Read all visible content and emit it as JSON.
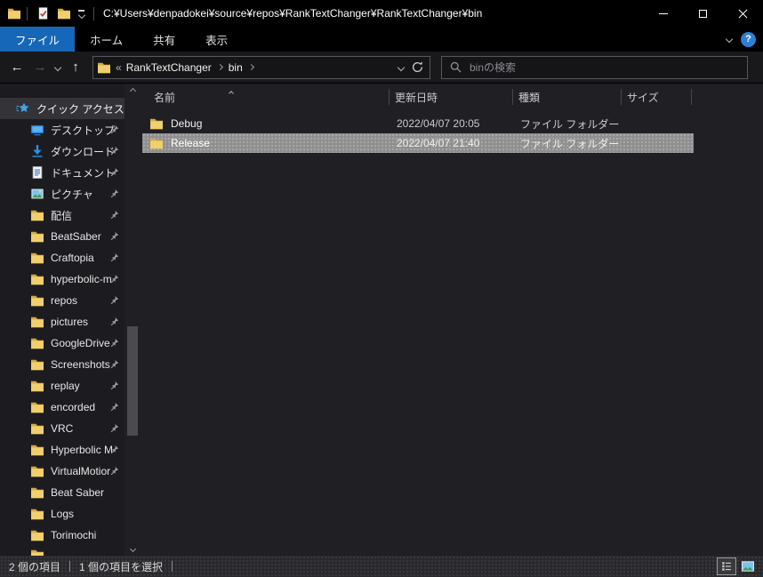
{
  "window": {
    "title_path": "C:¥Users¥denpadokei¥source¥repos¥RankTextChanger¥RankTextChanger¥bin"
  },
  "ribbon": {
    "tabs": [
      {
        "label": "ファイル",
        "active": true
      },
      {
        "label": "ホーム",
        "active": false
      },
      {
        "label": "共有",
        "active": false
      },
      {
        "label": "表示",
        "active": false
      }
    ],
    "help_glyph": "?"
  },
  "navbar": {
    "back_glyph": "←",
    "forward_glyph": "→",
    "up_glyph": "↑",
    "breadcrumb_overflow": "«",
    "breadcrumb": [
      {
        "label": "RankTextChanger"
      },
      {
        "label": "bin"
      }
    ],
    "search_placeholder": "binの検索"
  },
  "sidebar": {
    "quick_access_label": "クイック アクセス",
    "quick_access_icon": "quick-access-star-icon",
    "items": [
      {
        "label": "デスクトップ",
        "icon": "desktop-icon",
        "pinned": true
      },
      {
        "label": "ダウンロード",
        "icon": "download-icon",
        "pinned": true
      },
      {
        "label": "ドキュメント",
        "icon": "document-icon",
        "pinned": true
      },
      {
        "label": "ピクチャ",
        "icon": "picture-icon",
        "pinned": true
      },
      {
        "label": "配信",
        "icon": "folder-icon",
        "pinned": true
      },
      {
        "label": "BeatSaber",
        "icon": "folder-icon",
        "pinned": true
      },
      {
        "label": "Craftopia",
        "icon": "folder-icon",
        "pinned": true
      },
      {
        "label": "hyperbolic-m",
        "icon": "folder-icon",
        "pinned": true
      },
      {
        "label": "repos",
        "icon": "folder-icon",
        "pinned": true
      },
      {
        "label": "pictures",
        "icon": "folder-icon",
        "pinned": true
      },
      {
        "label": "GoogleDrive",
        "icon": "folder-icon",
        "pinned": true
      },
      {
        "label": "Screenshots",
        "icon": "folder-icon",
        "pinned": true
      },
      {
        "label": "replay",
        "icon": "folder-icon",
        "pinned": true
      },
      {
        "label": "encorded",
        "icon": "folder-icon",
        "pinned": true
      },
      {
        "label": "VRC",
        "icon": "folder-icon",
        "pinned": true
      },
      {
        "label": "Hyperbolic M",
        "icon": "folder-icon",
        "pinned": true
      },
      {
        "label": "VirtualMotior",
        "icon": "folder-icon",
        "pinned": true
      },
      {
        "label": "Beat Saber",
        "icon": "folder-icon",
        "pinned": false
      },
      {
        "label": "Logs",
        "icon": "folder-icon",
        "pinned": false
      },
      {
        "label": "Torimochi",
        "icon": "folder-icon",
        "pinned": false
      }
    ]
  },
  "filelist": {
    "columns": [
      "名前",
      "更新日時",
      "種類",
      "サイズ"
    ],
    "rows": [
      {
        "name": "Debug",
        "icon": "folder-icon",
        "modified": "2022/04/07 20:05",
        "type": "ファイル フォルダー",
        "size": "",
        "selected": false
      },
      {
        "name": "Release",
        "icon": "folder-icon",
        "modified": "2022/04/07 21:40",
        "type": "ファイル フォルダー",
        "size": "",
        "selected": true
      }
    ]
  },
  "statusbar": {
    "item_count": "2 個の項目",
    "selection_count": "1 個の項目を選択"
  },
  "colors": {
    "accent_blue": "#1667b8",
    "selection_gray": "#8f8f8f",
    "folder_yellow": "#eec256",
    "help_blue": "#2e80d2",
    "titlebar_black": "#000000",
    "panel_dark": "#202024"
  }
}
